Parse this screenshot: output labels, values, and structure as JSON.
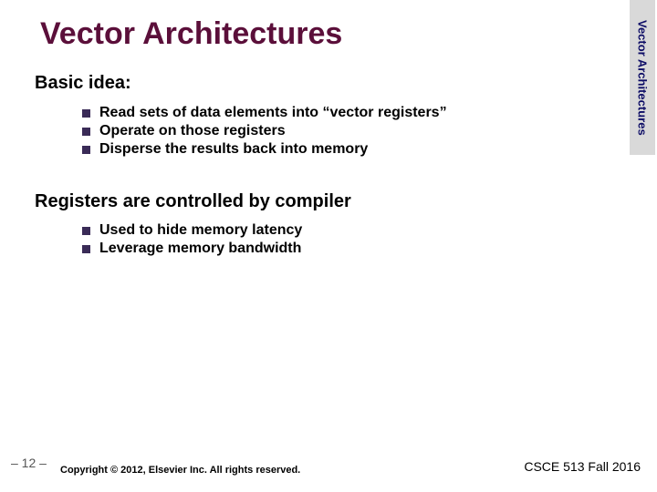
{
  "title": "Vector Architectures",
  "side_label": "Vector Architectures",
  "section1": {
    "heading": "Basic idea:"
  },
  "bullets1": {
    "b0": "Read sets of data elements into “vector registers”",
    "b1": "Operate on those registers",
    "b2": "Disperse the results back into memory"
  },
  "section2": {
    "heading": "Registers are controlled by compiler"
  },
  "bullets2": {
    "b0": "Used to hide memory latency",
    "b1": "Leverage memory bandwidth"
  },
  "footer": {
    "page": "– 12 –",
    "copyright": "Copyright © 2012, Elsevier Inc. All rights reserved.",
    "course": "CSCE 513 Fall 2016"
  }
}
